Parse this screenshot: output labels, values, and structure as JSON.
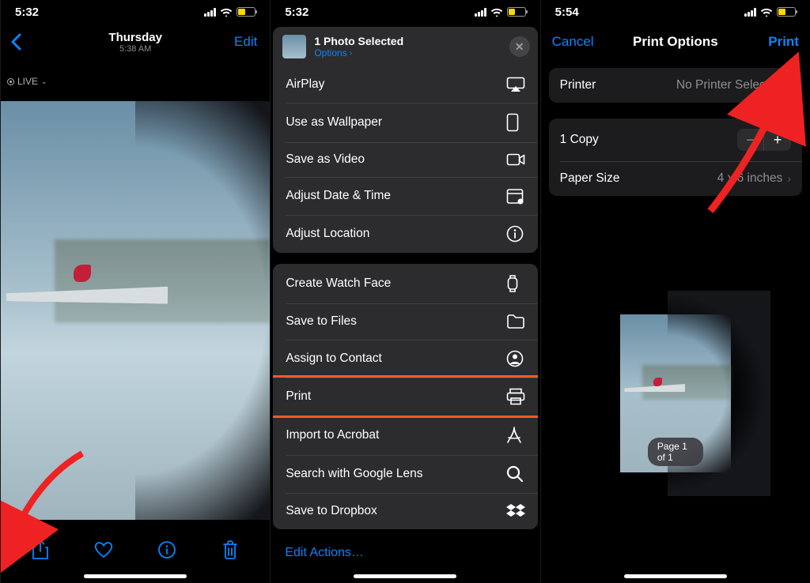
{
  "phone1": {
    "time": "5:32",
    "nav_title": "Thursday",
    "nav_subtitle": "5:38 AM",
    "edit": "Edit",
    "live": "LIVE"
  },
  "phone2": {
    "time": "5:32",
    "header_title": "1 Photo Selected",
    "header_options": "Options",
    "group1": [
      {
        "label": "AirPlay",
        "icon": "airplay-icon"
      },
      {
        "label": "Use as Wallpaper",
        "icon": "phone-icon"
      },
      {
        "label": "Save as Video",
        "icon": "video-icon"
      },
      {
        "label": "Adjust Date & Time",
        "icon": "calendar-icon"
      },
      {
        "label": "Adjust Location",
        "icon": "info-icon"
      }
    ],
    "group2": [
      {
        "label": "Create Watch Face",
        "icon": "watch-icon"
      },
      {
        "label": "Save to Files",
        "icon": "folder-icon"
      },
      {
        "label": "Assign to Contact",
        "icon": "contact-icon"
      },
      {
        "label": "Print",
        "icon": "print-icon",
        "highlight": true
      },
      {
        "label": "Import to Acrobat",
        "icon": "acrobat-icon"
      },
      {
        "label": "Search with Google Lens",
        "icon": "search-icon"
      },
      {
        "label": "Save to Dropbox",
        "icon": "dropbox-icon"
      }
    ],
    "edit_actions": "Edit Actions…"
  },
  "phone3": {
    "time": "5:54",
    "cancel": "Cancel",
    "title": "Print Options",
    "print": "Print",
    "printer_label": "Printer",
    "printer_value": "No Printer Selected",
    "copies": "1 Copy",
    "paper_label": "Paper Size",
    "paper_value": "4 x 6 inches",
    "page_badge": "Page 1 of 1"
  },
  "icons": {
    "airplay": "⏏",
    "phone": "📱",
    "video": "🎥",
    "calendar": "📅",
    "info": "ⓘ",
    "watch": "⌚",
    "folder": "🗂",
    "contact": "👤",
    "print": "🖨",
    "acrobat": "✒",
    "search": "🔍",
    "dropbox": "⬇"
  }
}
